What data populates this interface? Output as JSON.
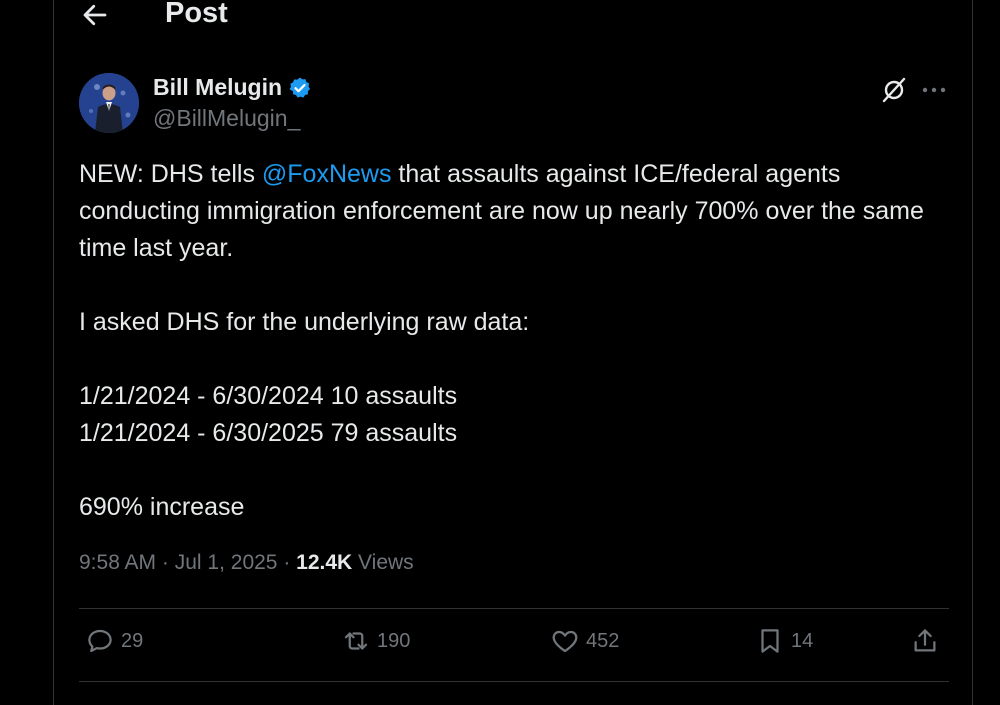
{
  "header": {
    "title": "Post"
  },
  "author": {
    "name": "Bill Melugin",
    "handle": "@BillMelugin_"
  },
  "tweet": {
    "line1_prefix": "NEW: DHS tells ",
    "mention": "@FoxNews",
    "line1_suffix": " that assaults against ICE/federal agents conducting immigration enforcement are now up nearly 700% over the same time last year.",
    "line2": "I asked DHS for the underlying raw data:",
    "line3": "1/21/2024 - 6/30/2024 10 assaults",
    "line4": "1/21/2024 - 6/30/2025 79 assaults",
    "line5": "690% increase"
  },
  "meta": {
    "time": "9:58 AM",
    "separator": " · ",
    "date": "Jul 1, 2025",
    "views_count": "12.4K",
    "views_label": " Views"
  },
  "actions": {
    "replies": "29",
    "reposts": "190",
    "likes": "452",
    "bookmarks": "14"
  },
  "colors": {
    "background": "#000000",
    "text": "#e7e9ea",
    "secondary": "#71767b",
    "accent": "#1d9bf0",
    "border": "#2f3336"
  },
  "icons": [
    "back-arrow-icon",
    "verified-badge-icon",
    "grok-icon",
    "more-icon",
    "reply-icon",
    "repost-icon",
    "like-icon",
    "bookmark-icon",
    "share-icon"
  ]
}
